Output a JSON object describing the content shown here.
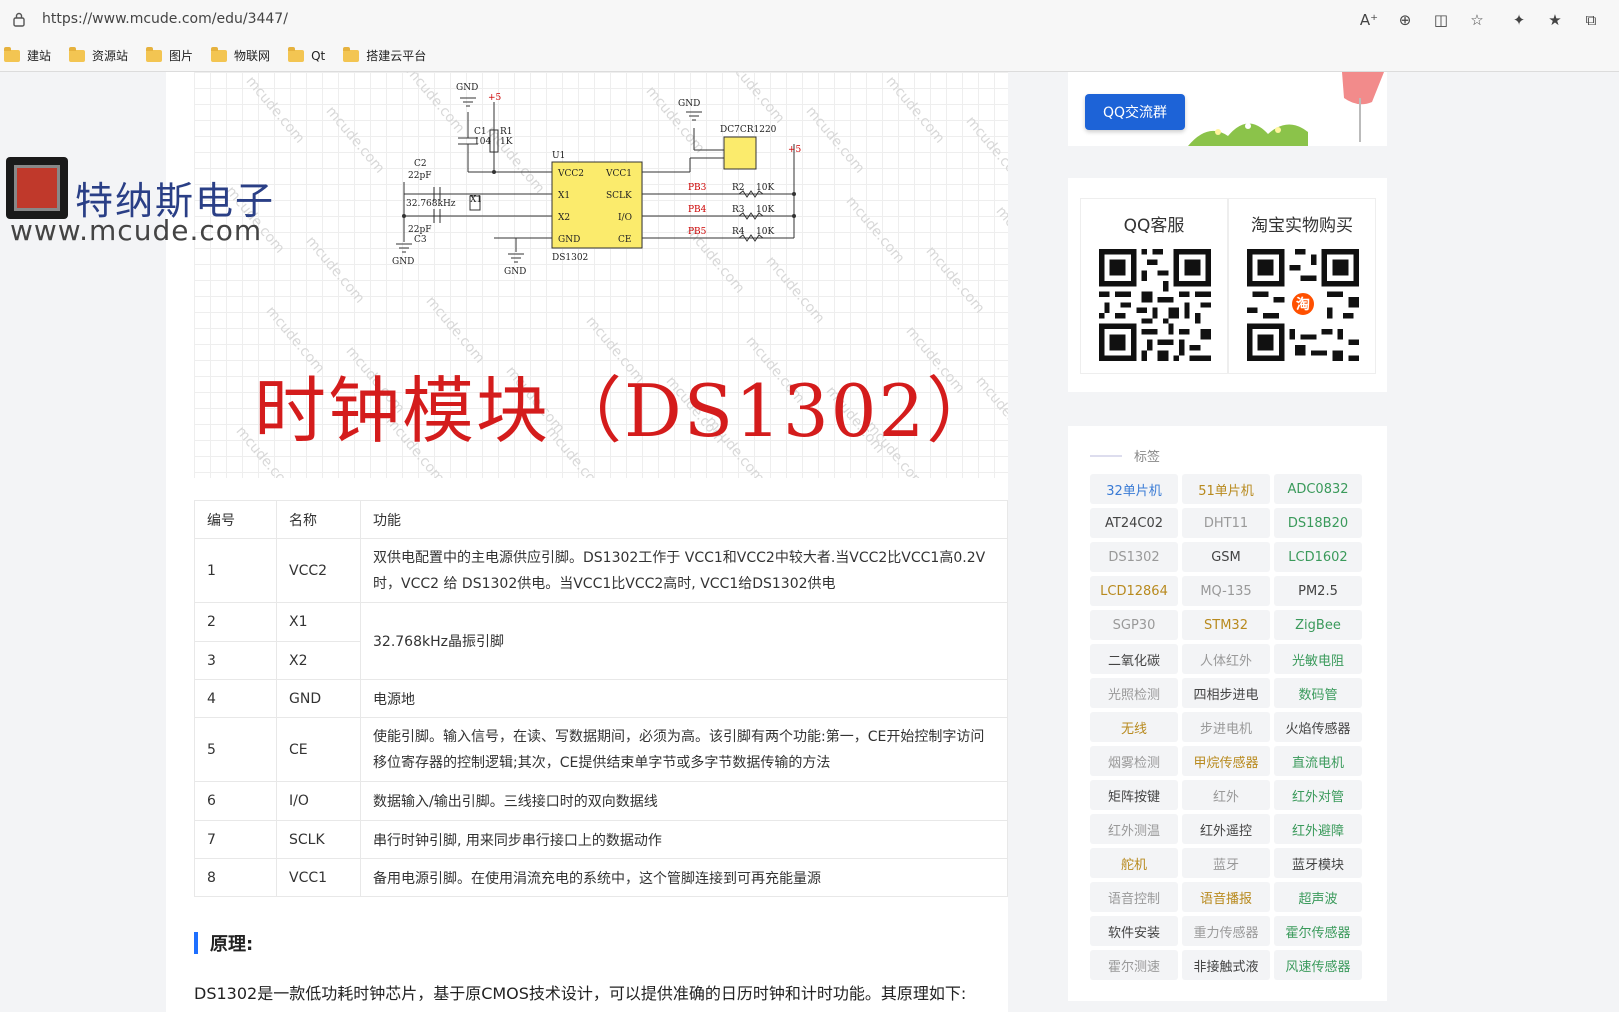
{
  "browser": {
    "url": "https://www.mcude.com/edu/3447/",
    "bookmarks": [
      "建站",
      "资源站",
      "图片",
      "物联网",
      "Qt",
      "搭建云平台"
    ]
  },
  "logo": {
    "cn": "特纳斯电子",
    "url": "www.mcude.com"
  },
  "figure": {
    "title": "时钟模块（DS1302）",
    "watermark": "mcude.com",
    "labels": {
      "gnd": "GND",
      "plus5": "+5",
      "c1": "C1",
      "c1v": "104",
      "r1": "R1",
      "r1v": "1K",
      "c2": "C2",
      "c2v": "22pF",
      "c3": "C3",
      "c3v": "22pF",
      "x1": "X1",
      "xtal": "32.768kHz",
      "u1": "U1",
      "chip": "DS1302",
      "dc": "DC7CR1220",
      "vcc2": "VCC2",
      "vcc1": "VCC1",
      "px1": "X1",
      "px2": "X2",
      "pgnd": "GND",
      "sclk": "SCLK",
      "io": "I/O",
      "ce": "CE",
      "pb3": "PB3",
      "pb4": "PB4",
      "pb5": "PB5",
      "r2": "R2",
      "r3": "R3",
      "r4": "R4",
      "r10k": "10K"
    }
  },
  "table": {
    "headers": [
      "编号",
      "名称",
      "功能"
    ],
    "rows": [
      {
        "no": "1",
        "name": "VCC2",
        "fn": "双供电配置中的主电源供应引脚。DS1302工作于 VCC1和VCC2中较大者.当VCC2比VCC1高0.2V时，VCC2 给 DS1302供电。当VCC1比VCC2高时, VCC1给DS1302供电"
      },
      {
        "no": "2",
        "name": "X1",
        "fn": "32.768kHz晶振引脚"
      },
      {
        "no": "3",
        "name": "X2",
        "fn": ""
      },
      {
        "no": "4",
        "name": "GND",
        "fn": "电源地"
      },
      {
        "no": "5",
        "name": "CE",
        "fn": "使能引脚。输入信号，在读、写数据期间，必须为高。该引脚有两个功能:第一，CE开始控制字访问移位寄存器的控制逻辑;其次，CE提供结束单字节或多字节数据传输的方法"
      },
      {
        "no": "6",
        "name": "I/O",
        "fn": "数据输入/输出引脚。三线接口时的双向数据线"
      },
      {
        "no": "7",
        "name": "SCLK",
        "fn": "串行时钟引脚, 用来同步串行接口上的数据动作"
      },
      {
        "no": "8",
        "name": "VCC1",
        "fn": "备用电源引脚。在使用涓流充电的系统中，这个管脚连接到可再充能量源"
      }
    ]
  },
  "section": {
    "title": "原理:",
    "paragraph": "DS1302是一款低功耗时钟芯片，基于原CMOS技术设计，可以提供准确的日历时钟和计时功能。其原理如下:"
  },
  "sidebar": {
    "qq_button": "QQ交流群",
    "qq_service": "QQ客服",
    "taobao": "淘宝实物购买",
    "taobao_badge": "淘",
    "tags_title": "标签",
    "tags": [
      {
        "label": "32单片机",
        "color": "#3a7bd5"
      },
      {
        "label": "51单片机",
        "color": "#b88a1e"
      },
      {
        "label": "ADC0832",
        "color": "#3a9a5b"
      },
      {
        "label": "AT24C02",
        "color": "#444444"
      },
      {
        "label": "DHT11",
        "color": "#999999"
      },
      {
        "label": "DS18B20",
        "color": "#3a9a5b"
      },
      {
        "label": "DS1302",
        "color": "#999999"
      },
      {
        "label": "GSM",
        "color": "#444444"
      },
      {
        "label": "LCD1602",
        "color": "#3a9a5b"
      },
      {
        "label": "LCD12864",
        "color": "#b88a1e"
      },
      {
        "label": "MQ-135",
        "color": "#999999"
      },
      {
        "label": "PM2.5",
        "color": "#444444"
      },
      {
        "label": "SGP30",
        "color": "#999999"
      },
      {
        "label": "STM32",
        "color": "#b88a1e"
      },
      {
        "label": "ZigBee",
        "color": "#3a9a5b"
      },
      {
        "label": "二氧化碳",
        "color": "#444444"
      },
      {
        "label": "人体红外",
        "color": "#999999"
      },
      {
        "label": "光敏电阻",
        "color": "#3a9a5b"
      },
      {
        "label": "光照检测",
        "color": "#999999"
      },
      {
        "label": "四相步进电",
        "color": "#444444"
      },
      {
        "label": "数码管",
        "color": "#3a9a5b"
      },
      {
        "label": "无线",
        "color": "#b88a1e"
      },
      {
        "label": "步进电机",
        "color": "#999999"
      },
      {
        "label": "火焰传感器",
        "color": "#444444"
      },
      {
        "label": "烟雾检测",
        "color": "#999999"
      },
      {
        "label": "甲烷传感器",
        "color": "#b88a1e"
      },
      {
        "label": "直流电机",
        "color": "#3a9a5b"
      },
      {
        "label": "矩阵按键",
        "color": "#444444"
      },
      {
        "label": "红外",
        "color": "#999999"
      },
      {
        "label": "红外对管",
        "color": "#3a9a5b"
      },
      {
        "label": "红外测温",
        "color": "#999999"
      },
      {
        "label": "红外遥控",
        "color": "#444444"
      },
      {
        "label": "红外避障",
        "color": "#3a9a5b"
      },
      {
        "label": "舵机",
        "color": "#b88a1e"
      },
      {
        "label": "蓝牙",
        "color": "#999999"
      },
      {
        "label": "蓝牙模块",
        "color": "#444444"
      },
      {
        "label": "语音控制",
        "color": "#999999"
      },
      {
        "label": "语音播报",
        "color": "#b88a1e"
      },
      {
        "label": "超声波",
        "color": "#3a9a5b"
      },
      {
        "label": "软件安装",
        "color": "#444444"
      },
      {
        "label": "重力传感器",
        "color": "#999999"
      },
      {
        "label": "霍尔传感器",
        "color": "#3a9a5b"
      },
      {
        "label": "霍尔测速",
        "color": "#999999"
      },
      {
        "label": "非接触式液",
        "color": "#444444"
      },
      {
        "label": "风速传感器",
        "color": "#3a9a5b"
      }
    ]
  }
}
